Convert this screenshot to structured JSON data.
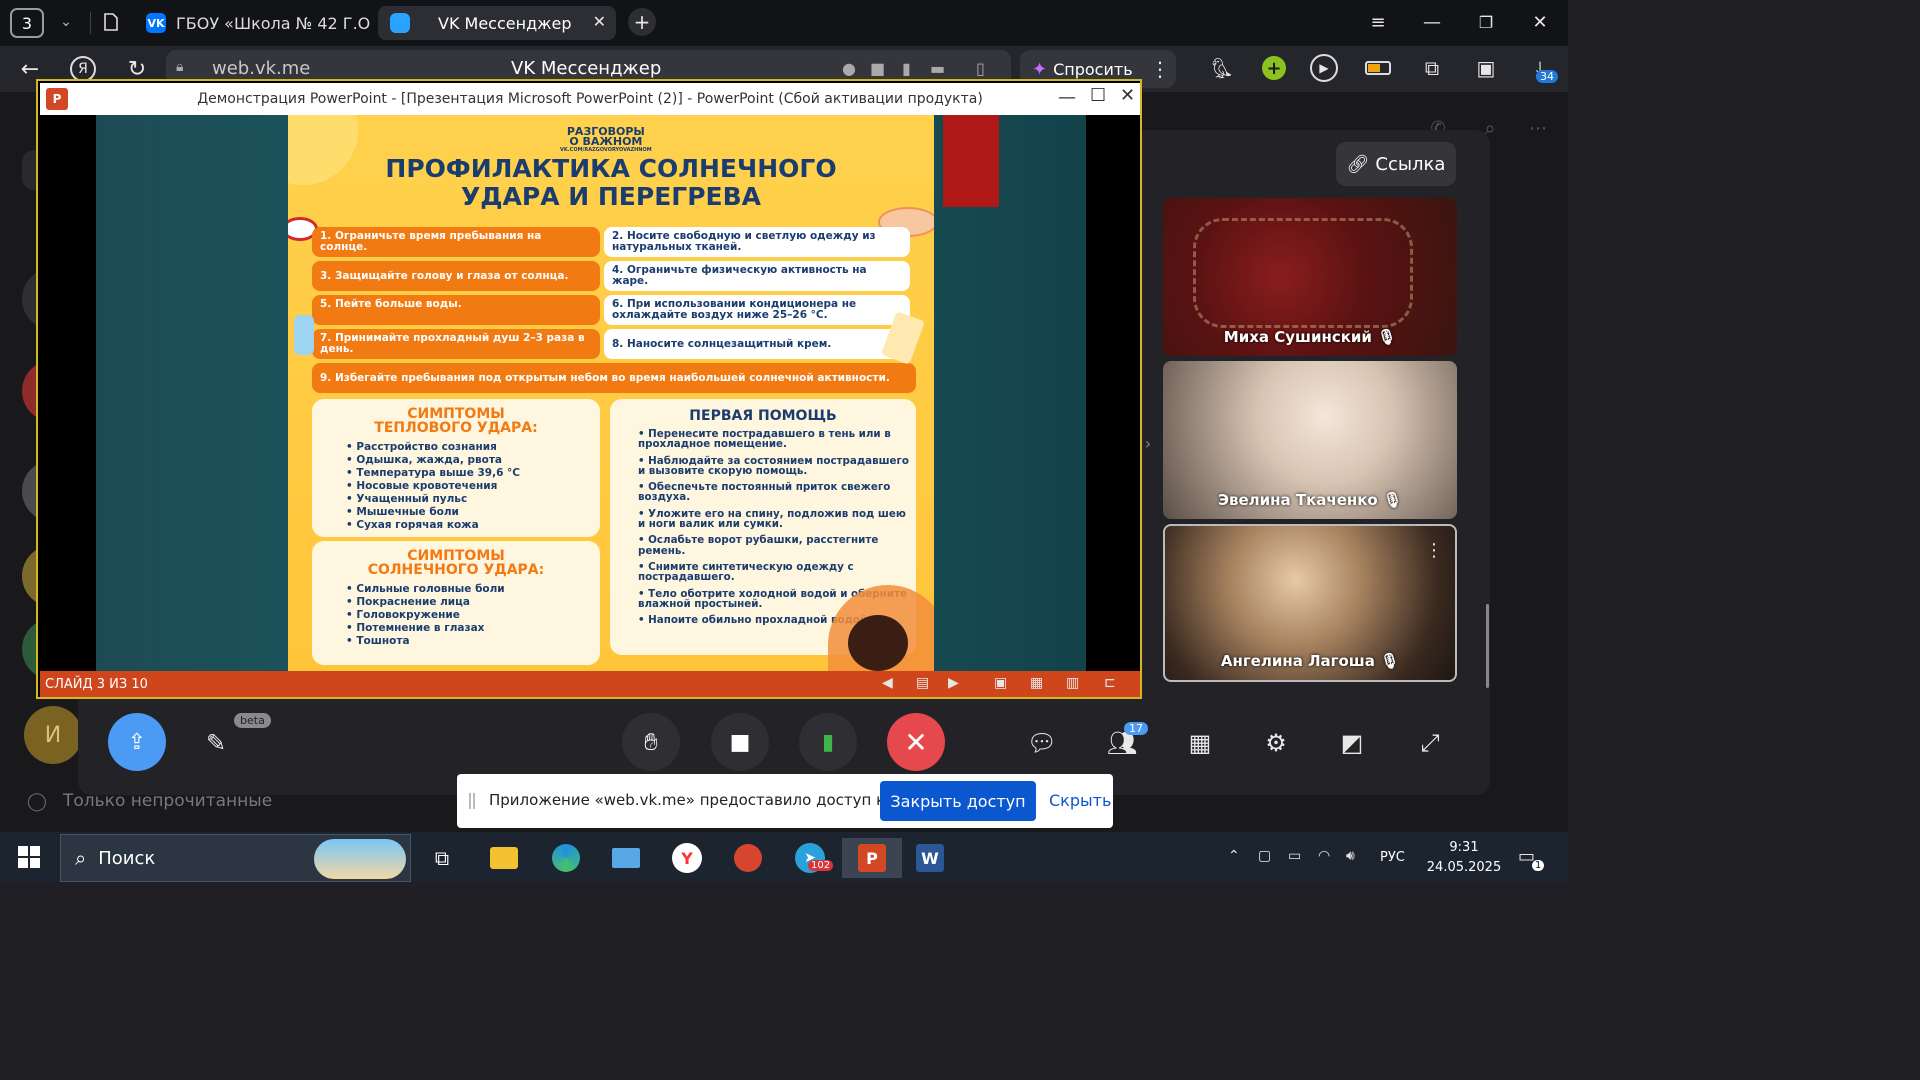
{
  "browser": {
    "tab_count": "3",
    "tabs": [
      {
        "label": "ГБОУ «Школа № 42 Г.О. Г"
      },
      {
        "label": "VK Мессенджер"
      }
    ],
    "url": "web.vk.me",
    "page_title": "VK Мессенджер",
    "ask_label": "Спросить",
    "downloads_badge": "34"
  },
  "ppt": {
    "window_title": "Демонстрация PowerPoint - [Презентация Microsoft PowerPoint (2)] - PowerPoint (Сбой активации продукта)",
    "status": "СЛАЙД 3 ИЗ 10"
  },
  "slide": {
    "logo_top": "РАЗГОВОРЫ",
    "logo_bottom": "О ВАЖНОМ",
    "logo_url": "VK.COM/RAZGOVORYOVAZHNOM",
    "title_line1": "ПРОФИЛАКТИКА СОЛНЕЧНОГО",
    "title_line2": "УДАРА И ПЕРЕГРЕВА",
    "tips": [
      "1. Ограничьте время пребывания на солнце.",
      "2. Носите свободную и светлую одежду из натуральных тканей.",
      "3. Защищайте голову и глаза от солнца.",
      "4. Ограничьте физическую активность на жаре.",
      "5. Пейте больше воды.",
      "6. При использовании кондиционера не охлаждайте воздух ниже 25–26 °С.",
      "7. Принимайте прохладный душ 2–3 раза в день.",
      "8. Наносите солнцезащитный крем.",
      "9. Избегайте пребывания под открытым небом во время наибольшей солнечной активности."
    ],
    "heat_title": "СИМПТОМЫ ТЕПЛОВОГО УДАРА:",
    "heat_items": [
      "Расстройство сознания",
      "Одышка, жажда, рвота",
      "Температура выше 39,6 °С",
      "Носовые кровотечения",
      "Учащенный пульс",
      "Мышечные боли",
      "Сухая горячая кожа"
    ],
    "sun_title": "СИМПТОМЫ СОЛНЕЧНОГО УДАРА:",
    "sun_items": [
      "Сильные головные боли",
      "Покраснение лица",
      "Головокружение",
      "Потемнение в глазах",
      "Тошнота"
    ],
    "aid_title": "ПЕРВАЯ ПОМОЩЬ",
    "aid_items": [
      "Перенесите пострадавшего в тень или в прохладное помещение.",
      "Наблюдайте за состоянием пострадавшего и вызовите скорую помощь.",
      "Обеспечьте постоянный приток свежего воздуха.",
      "Уложите его на спину, подложив под шею и ноги валик или сумки.",
      "Ослабьте ворот рубашки, расстегните ремень.",
      "Снимите синтетическую одежду с пострадавшего.",
      "Тело оботрите холодной водой и оберните влажной простыней.",
      "Напоите обильно прохладной водой."
    ]
  },
  "call": {
    "link_label": "Ссылка",
    "participants": [
      {
        "name": "Миха Сушинский"
      },
      {
        "name": "Эвелина Ткаченко"
      },
      {
        "name": "Ангелина Лагоша"
      }
    ],
    "participants_badge": "17",
    "beta_label": "beta"
  },
  "sidebar": {
    "avatar_letter": "И",
    "unread_filter": "Только непрочитанные"
  },
  "banner": {
    "text": "Приложение «web.vk.me» предоставило доступ к окну.",
    "stop_label": "Закрыть доступ",
    "hide_label": "Скрыть"
  },
  "taskbar": {
    "search_placeholder": "Поиск",
    "telegram_badge": "102",
    "lang": "РУС",
    "time": "9:31",
    "date": "24.05.2025",
    "notif_count": "1"
  }
}
